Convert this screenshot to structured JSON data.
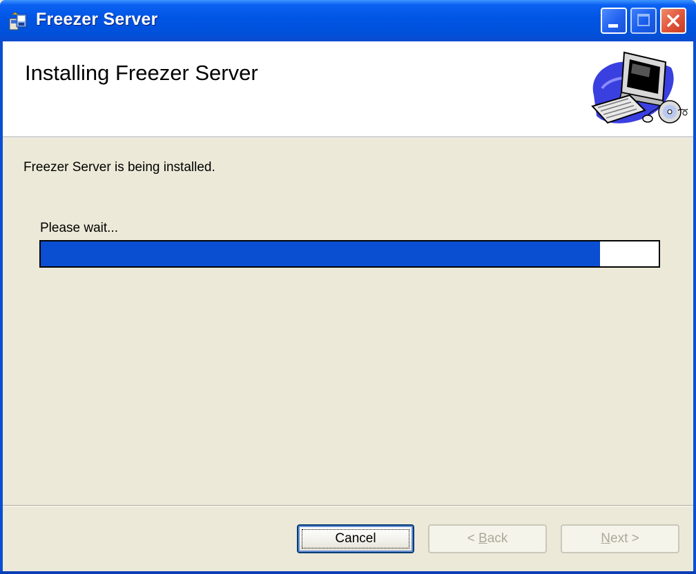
{
  "window": {
    "title": "Freezer Server",
    "icons": {
      "app": "installer-icon",
      "minimize": "minimize-icon",
      "maximize": "maximize-icon",
      "close": "close-icon"
    }
  },
  "banner": {
    "title": "Installing Freezer Server",
    "graphic": "computer-cd-graphic"
  },
  "body": {
    "status": "Freezer Server is being installed.",
    "progress_label": "Please wait...",
    "progress_fraction": 0.905
  },
  "buttons": {
    "cancel": "Cancel",
    "back_prefix": "< ",
    "back_key": "B",
    "back_rest": "ack",
    "next_key": "N",
    "next_rest": "ext >"
  },
  "colors": {
    "titlebar": "#0054e3",
    "progress_fill": "#0a4fd1",
    "dialog_bg": "#ece9d8"
  }
}
